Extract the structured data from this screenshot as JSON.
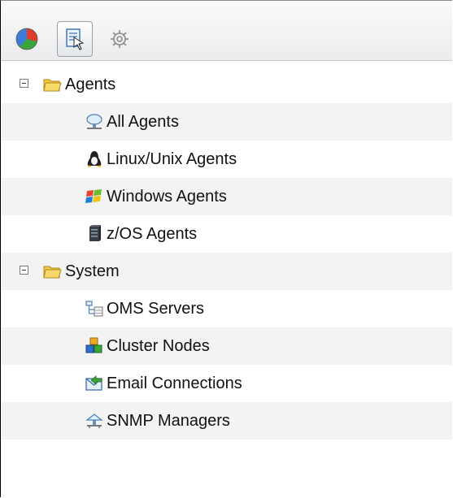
{
  "toolbar": {
    "buttons": [
      {
        "name": "pie-chart-icon",
        "pressed": false
      },
      {
        "name": "configure-icon",
        "pressed": true
      },
      {
        "name": "gear-icon",
        "pressed": false
      }
    ]
  },
  "tree": {
    "groups": [
      {
        "label": "Agents",
        "expanded": true,
        "icon": "folder-icon",
        "children": [
          {
            "label": "All Agents",
            "icon": "network-cloud-icon"
          },
          {
            "label": "Linux/Unix Agents",
            "icon": "penguin-icon"
          },
          {
            "label": "Windows Agents",
            "icon": "windows-flag-icon"
          },
          {
            "label": "z/OS Agents",
            "icon": "mainframe-icon"
          }
        ]
      },
      {
        "label": "System",
        "expanded": true,
        "icon": "folder-icon",
        "children": [
          {
            "label": "OMS Servers",
            "icon": "server-tree-icon"
          },
          {
            "label": "Cluster Nodes",
            "icon": "cluster-cubes-icon"
          },
          {
            "label": "Email Connections",
            "icon": "email-arrow-icon"
          },
          {
            "label": "SNMP Managers",
            "icon": "snmp-network-icon"
          }
        ]
      }
    ]
  },
  "colors": {
    "row_alt": "#f3f3f3",
    "text": "#111111",
    "folder": "#f2c744"
  }
}
